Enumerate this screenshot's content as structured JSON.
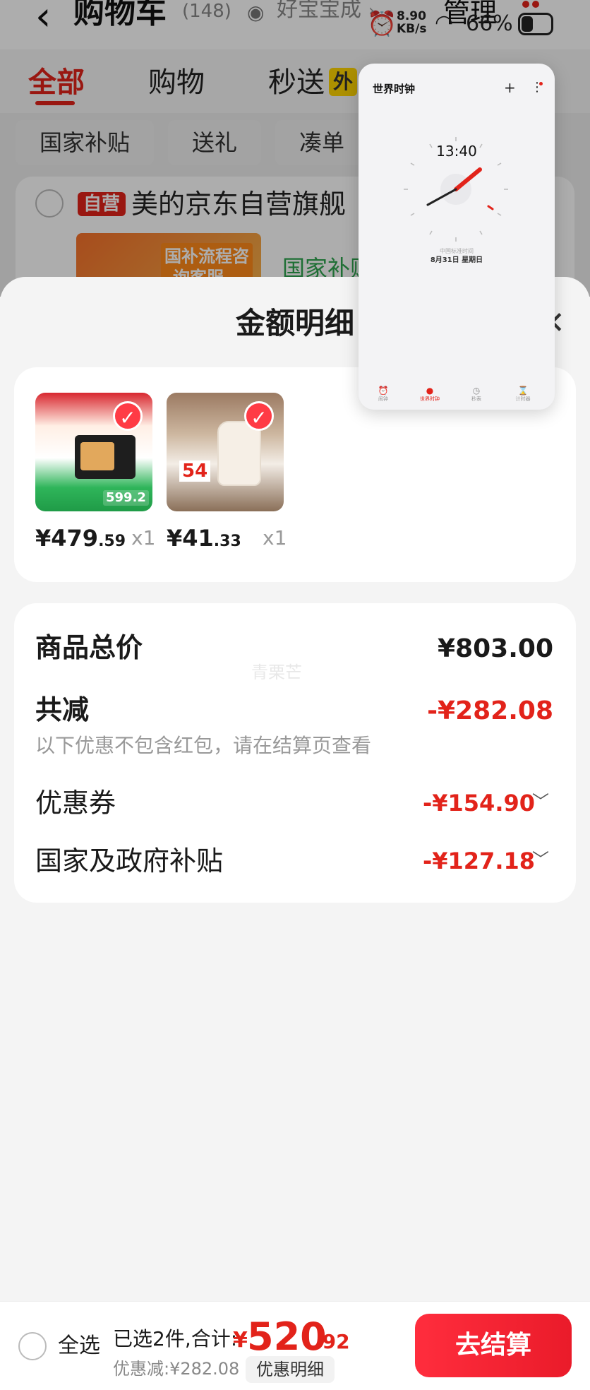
{
  "status_bar": {
    "net_speed_value": "8.90",
    "net_speed_unit": "KB/s",
    "battery": "66%"
  },
  "header": {
    "back_icon": "chevron-left-icon",
    "title": "购物车",
    "count": "(148)",
    "promo": "好宝宝成",
    "manage": "管理"
  },
  "tabs": [
    "全部",
    "购物",
    "秒送"
  ],
  "tab_tag": "外",
  "chips": [
    "国家补贴",
    "送礼",
    "凑单"
  ],
  "store": {
    "self_tag": "自营",
    "name": "美的京东自营旗舰",
    "ad_text": "国补流程咨询客服。",
    "subsidy_text": "国家补贴"
  },
  "sheet": {
    "title": "金额明细",
    "products": [
      {
        "price_int": "¥479",
        "price_dec": ".59",
        "qty": "x1"
      },
      {
        "price_int": "¥41",
        "price_dec": ".33",
        "qty": "x1"
      }
    ],
    "thumb_texts": {
      "microwave_price": "599.2",
      "kettle_price": "54"
    },
    "detail": {
      "total_label": "商品总价",
      "total_value": "¥803.00",
      "reduce_label": "共减",
      "reduce_value": "-¥282.08",
      "reduce_note": "以下优惠不包含红包，请在结算页查看",
      "coupon_label": "优惠券",
      "coupon_value": "-¥154.90",
      "subsidy_label": "国家及政府补贴",
      "subsidy_value": "-¥127.18",
      "watermark": "青栗芒"
    }
  },
  "clock_widget": {
    "title": "世界时钟",
    "time": "13:40",
    "city": "中国标准时间",
    "date": "8月31日 星期日",
    "tabs": [
      "闹钟",
      "世界时钟",
      "秒表",
      "计时器"
    ],
    "active_tab": 1
  },
  "bottom_bar": {
    "select_all": "全选",
    "selected_info": "已选2件,合计:",
    "total_yen": "¥",
    "total_int": "520",
    "total_dec": ".92",
    "discount_note": "优惠减:¥282.08",
    "detail_button": "优惠明细",
    "checkout_button": "去结算"
  },
  "colors": {
    "accent_red": "#e2231a",
    "green": "#2ea44f"
  }
}
